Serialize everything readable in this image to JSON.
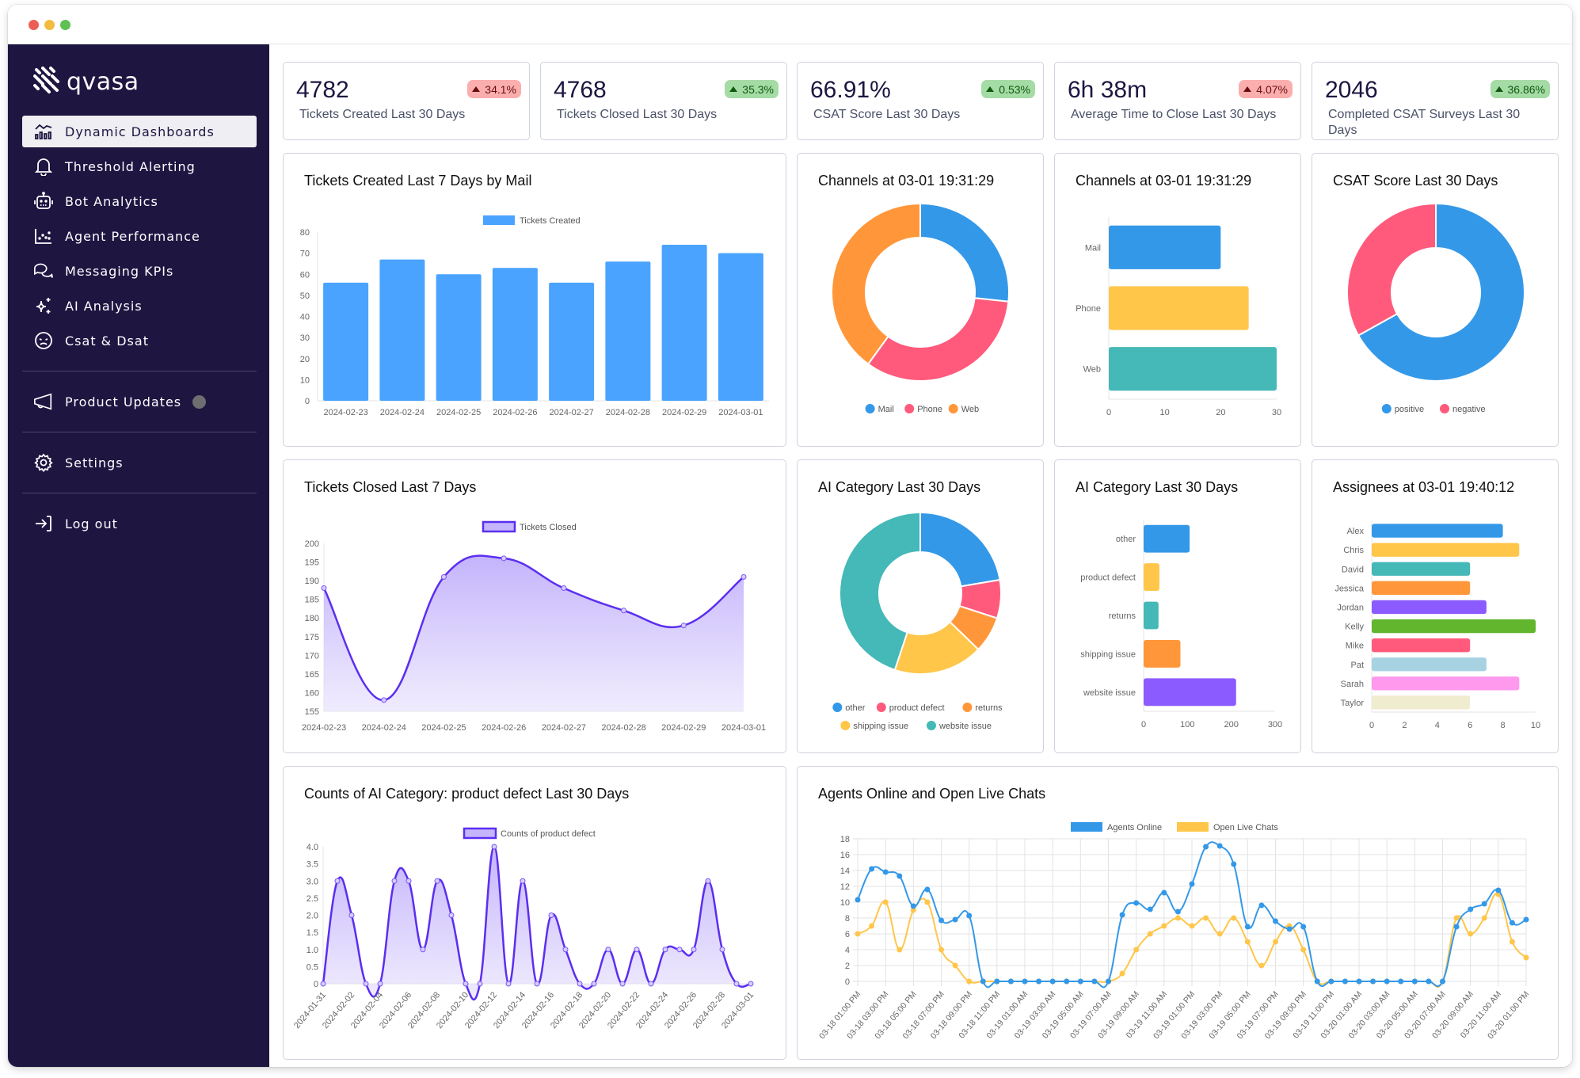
{
  "window": {
    "controls": [
      "close",
      "minimize",
      "maximize"
    ]
  },
  "sidebar": {
    "logo_text": "qvasa",
    "items": [
      {
        "label": "Dynamic Dashboards",
        "icon": "chart-analytics-icon",
        "active": true
      },
      {
        "label": "Threshold Alerting",
        "icon": "bell-icon"
      },
      {
        "label": "Bot Analytics",
        "icon": "robot-icon"
      },
      {
        "label": "Agent Performance",
        "icon": "scatter-plot-icon"
      },
      {
        "label": "Messaging KPIs",
        "icon": "chat-bubbles-icon"
      },
      {
        "label": "AI Analysis",
        "icon": "sparkles-icon"
      },
      {
        "label": "Csat & Dsat",
        "icon": "sad-face-icon"
      }
    ],
    "product_updates": {
      "label": "Product Updates",
      "icon": "megaphone-icon"
    },
    "settings": {
      "label": "Settings",
      "icon": "gear-icon"
    },
    "logout": {
      "label": "Log out",
      "icon": "logout-icon"
    }
  },
  "kpis": [
    {
      "value": "4782",
      "label": "Tickets Created Last 30 Days",
      "delta": "34.1%",
      "trend": "up",
      "status": "bad"
    },
    {
      "value": "4768",
      "label": "Tickets Closed Last 30 Days",
      "delta": "35.3%",
      "trend": "up",
      "status": "good"
    },
    {
      "value": "66.91%",
      "label": "CSAT Score Last 30 Days",
      "delta": "0.53%",
      "trend": "up",
      "status": "good"
    },
    {
      "value": "6h 38m",
      "label": "Average Time to Close Last 30 Days",
      "delta": "4.07%",
      "trend": "up",
      "status": "bad"
    },
    {
      "value": "2046",
      "label": "Completed CSAT Surveys Last 30 Days",
      "delta": "36.86%",
      "trend": "up",
      "status": "good"
    }
  ],
  "colors": {
    "blue": "#3498e8",
    "pink": "#ff5a7c",
    "orange": "#ff973a",
    "yellow": "#ffc64a",
    "teal": "#45b8b8",
    "purple": "#8c5bff",
    "green": "#62b62e",
    "lightblue": "#a7d2e1",
    "magenta": "#ff99ee",
    "beige": "#efecd0",
    "bar_blue": "#4aa3ff",
    "line_purple": "#5b2ef0",
    "sidebar_bg": "#1e1541"
  },
  "chart_data": [
    {
      "id": "tickets_created",
      "type": "bar",
      "title": "Tickets Created Last 7 Days by Mail",
      "legend": [
        "Tickets Created"
      ],
      "legend_position": "top",
      "categories": [
        "2024-02-23",
        "2024-02-24",
        "2024-02-25",
        "2024-02-26",
        "2024-02-27",
        "2024-02-28",
        "2024-02-29",
        "2024-03-01"
      ],
      "values": [
        56,
        67,
        60,
        63,
        56,
        66,
        74,
        70
      ],
      "ylim": [
        0,
        80
      ],
      "yticks": [
        0,
        10,
        20,
        30,
        40,
        50,
        60,
        70,
        80
      ],
      "grid": false
    },
    {
      "id": "channels_donut",
      "type": "pie",
      "donut": true,
      "title": "Channels at 03-01 19:31:29",
      "labels": [
        "Mail",
        "Phone",
        "Web"
      ],
      "values": [
        20,
        25,
        30
      ],
      "legend_position": "bottom"
    },
    {
      "id": "channels_bar",
      "type": "bar",
      "orientation": "horizontal",
      "title": "Channels at 03-01 19:31:29",
      "categories": [
        "Mail",
        "Phone",
        "Web"
      ],
      "values": [
        20,
        25,
        30
      ],
      "xlim": [
        0,
        30
      ],
      "xticks": [
        0,
        10,
        20,
        30
      ]
    },
    {
      "id": "csat_donut",
      "type": "pie",
      "donut": true,
      "title": "CSAT Score Last 30 Days",
      "labels": [
        "positive",
        "negative"
      ],
      "values": [
        66.91,
        33.09
      ],
      "legend_position": "bottom"
    },
    {
      "id": "tickets_closed",
      "type": "area",
      "title": "Tickets Closed Last 7 Days",
      "legend": [
        "Tickets Closed"
      ],
      "legend_position": "top",
      "categories": [
        "2024-02-23",
        "2024-02-24",
        "2024-02-25",
        "2024-02-26",
        "2024-02-27",
        "2024-02-28",
        "2024-02-29",
        "2024-03-01"
      ],
      "values": [
        188,
        158,
        191,
        196,
        188,
        182,
        178,
        191
      ],
      "ylim": [
        155,
        200
      ],
      "yticks": [
        155,
        160,
        165,
        170,
        175,
        180,
        185,
        190,
        195,
        200
      ]
    },
    {
      "id": "ai_category_donut",
      "type": "pie",
      "donut": true,
      "title": "AI Category Last 30 Days",
      "labels": [
        "other",
        "product defect",
        "returns",
        "shipping issue",
        "website issue"
      ],
      "values": [
        105,
        36,
        34,
        84,
        211
      ],
      "legend_position": "bottom"
    },
    {
      "id": "ai_category_bar",
      "type": "bar",
      "orientation": "horizontal",
      "title": "AI Category Last 30 Days",
      "categories": [
        "other",
        "product defect",
        "returns",
        "shipping issue",
        "website issue"
      ],
      "values": [
        105,
        36,
        34,
        84,
        211
      ],
      "xlim": [
        0,
        300
      ],
      "xticks": [
        0,
        100,
        200,
        300
      ]
    },
    {
      "id": "assignees",
      "type": "bar",
      "orientation": "horizontal",
      "title": "Assignees at 03-01 19:40:12",
      "categories": [
        "Alex",
        "Chris",
        "David",
        "Jessica",
        "Jordan",
        "Kelly",
        "Mike",
        "Pat",
        "Sarah",
        "Taylor"
      ],
      "values": [
        8,
        9,
        6,
        6,
        7,
        10,
        6,
        7,
        9,
        6
      ],
      "xlim": [
        0,
        10
      ],
      "xticks": [
        0,
        2,
        4,
        6,
        8,
        10
      ]
    },
    {
      "id": "product_defect",
      "type": "area",
      "title": "Counts of AI Category: product defect Last 30 Days",
      "legend": [
        "Counts of product defect"
      ],
      "legend_position": "top",
      "x": [
        "2024-01-31",
        "2024-02-01",
        "2024-02-02",
        "2024-02-03",
        "2024-02-04",
        "2024-02-05",
        "2024-02-06",
        "2024-02-07",
        "2024-02-08",
        "2024-02-09",
        "2024-02-10",
        "2024-02-11",
        "2024-02-12",
        "2024-02-13",
        "2024-02-14",
        "2024-02-15",
        "2024-02-16",
        "2024-02-17",
        "2024-02-18",
        "2024-02-19",
        "2024-02-20",
        "2024-02-21",
        "2024-02-22",
        "2024-02-23",
        "2024-02-24",
        "2024-02-25",
        "2024-02-26",
        "2024-02-27",
        "2024-02-28",
        "2024-02-29",
        "2024-03-01"
      ],
      "tick_labels": [
        "2024-01-31",
        "2024-02-02",
        "2024-02-04",
        "2024-02-06",
        "2024-02-08",
        "2024-02-10",
        "2024-02-12",
        "2024-02-14",
        "2024-02-16",
        "2024-02-18",
        "2024-02-20",
        "2024-02-22",
        "2024-02-24",
        "2024-02-26",
        "2024-02-28",
        "2024-03-01"
      ],
      "values": [
        0,
        3,
        2,
        0,
        0,
        3,
        3,
        1,
        3,
        2,
        0,
        0,
        4,
        0,
        3,
        0,
        2,
        1,
        0,
        0,
        1,
        0,
        1,
        0,
        1,
        1,
        1,
        3,
        1,
        0,
        0
      ],
      "ylim": [
        0,
        4
      ],
      "yticks": [
        0,
        0.5,
        1.0,
        1.5,
        2.0,
        2.5,
        3.0,
        3.5,
        4.0
      ]
    },
    {
      "id": "agents_chats",
      "type": "line",
      "title": "Agents Online and Open Live Chats",
      "legend_position": "top",
      "x_start": "03-18 01:00 PM",
      "x_end": "03-20 01:00 PM",
      "x_step": "1 hour",
      "tick_labels": [
        "03-18 01:00 PM",
        "03-18 03:00 PM",
        "03-18 05:00 PM",
        "03-18 07:00 PM",
        "03-18 09:00 PM",
        "03-18 11:00 PM",
        "03-19 01:00 AM",
        "03-19 03:00 AM",
        "03-19 05:00 AM",
        "03-19 07:00 AM",
        "03-19 09:00 AM",
        "03-19 11:00 AM",
        "03-19 01:00 PM",
        "03-19 03:00 PM",
        "03-19 05:00 PM",
        "03-19 07:00 PM",
        "03-19 09:00 PM",
        "03-19 11:00 PM",
        "03-20 01:00 AM",
        "03-20 03:00 AM",
        "03-20 05:00 AM",
        "03-20 07:00 AM",
        "03-20 09:00 AM",
        "03-20 11:00 AM",
        "03-20 01:00 PM"
      ],
      "series": [
        {
          "name": "Agents Online",
          "color": "#3498e8",
          "values": [
            10.3,
            14.2,
            13.8,
            13.3,
            9.5,
            11.6,
            7.7,
            7.8,
            8.3,
            0,
            0,
            0,
            0,
            0,
            0,
            0,
            0,
            0,
            0,
            8.4,
            9.9,
            9.1,
            11.2,
            8.8,
            12.3,
            17.0,
            17.1,
            14.8,
            6.9,
            9.6,
            7.6,
            6.6,
            6.9,
            0,
            0,
            0,
            0,
            0,
            0,
            0,
            0,
            0,
            0,
            6.9,
            9.1,
            9.8,
            11.5,
            7.4,
            7.8
          ]
        },
        {
          "name": "Open Live Chats",
          "color": "#ffc64a",
          "values": [
            6,
            7,
            10,
            4,
            9,
            10,
            4,
            2,
            0,
            0,
            0,
            0,
            0,
            0,
            0,
            0,
            0,
            0,
            0,
            1,
            4,
            6,
            7,
            8,
            7,
            8,
            6,
            8,
            5,
            2,
            5,
            7,
            4,
            0,
            0,
            0,
            0,
            0,
            0,
            0,
            0,
            0,
            0,
            8,
            6,
            8,
            11,
            5,
            3
          ]
        }
      ],
      "ylim": [
        0,
        18
      ],
      "yticks": [
        0,
        2,
        4,
        6,
        8,
        10,
        12,
        14,
        16,
        18
      ],
      "grid": true
    }
  ]
}
